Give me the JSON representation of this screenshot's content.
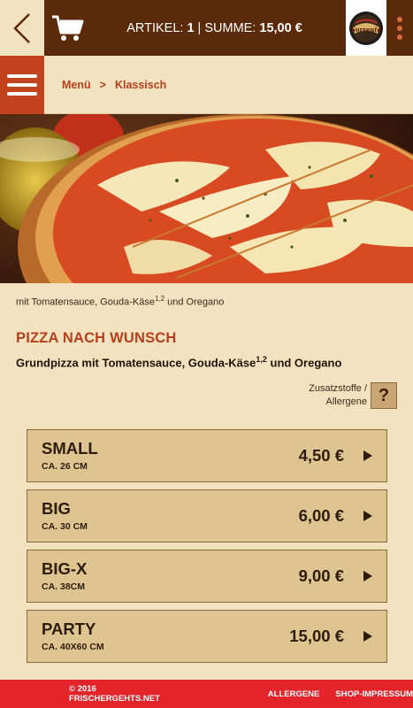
{
  "header": {
    "cart_label": "ARTIKEL:",
    "cart_count": "1",
    "separator": "|",
    "sum_label": "SUMME:",
    "sum_value": "15,00 €",
    "logo_text": "Sorrento"
  },
  "breadcrumb": {
    "items": [
      "Menü",
      "Klassisch"
    ],
    "separator": ">"
  },
  "caption": {
    "text_before": "mit Tomatensauce, Gouda-Käse",
    "sup": "1,2",
    "text_after": " und Oregano"
  },
  "product": {
    "title": "PIZZA NACH WUNSCH",
    "desc_before": "Grundpizza mit Tomatensauce, Gouda-Käse",
    "desc_sup": "1,2",
    "desc_after": " und Oregano",
    "allergen_line1": "Zusatzstoffe /",
    "allergen_line2": "Allergene",
    "help_label": "?"
  },
  "sizes": [
    {
      "name": "SMALL",
      "sub": "CA. 26 CM",
      "price": "4,50 €"
    },
    {
      "name": "BIG",
      "sub": "CA. 30 CM",
      "price": "6,00 €"
    },
    {
      "name": "BIG-X",
      "sub": "CA. 38CM",
      "price": "9,00 €"
    },
    {
      "name": "PARTY",
      "sub": "CA. 40X60 CM",
      "price": "15,00 €"
    }
  ],
  "footer": {
    "copyright": "© 2016 FRISCHERGEHTS.NET",
    "allergene": "ALLERGENE",
    "impressum": "SHOP-IMPRESSUM"
  },
  "colors": {
    "header_brown": "#5a2a0a",
    "accent_red": "#b5401d",
    "menu_red": "#c1441f",
    "footer_red": "#e3242b",
    "background_cream": "#f3e2bf",
    "button_tan": "#ddc491"
  }
}
